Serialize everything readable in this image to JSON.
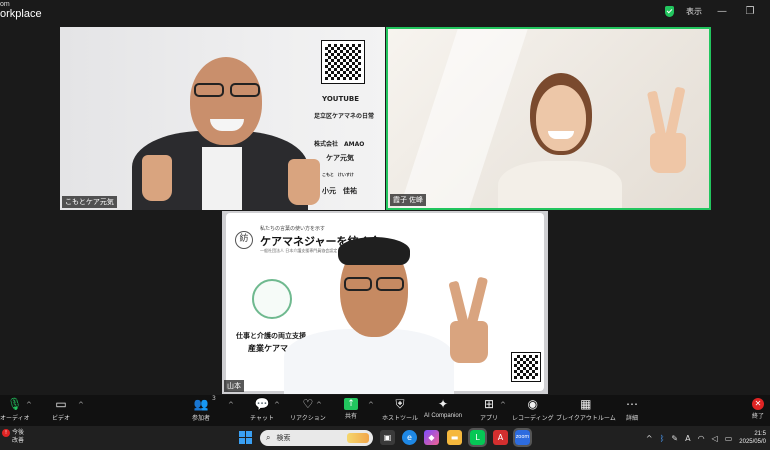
{
  "window": {
    "title_line1": "om",
    "title_line2": "orkplace",
    "view_label": "表示",
    "minimize": "—",
    "restore": "❐"
  },
  "tiles": {
    "a": {
      "name": "こもとケア元気",
      "slide_lines": [
        "YOUTUBE",
        "足立区ケアマネの日常",
        "株式会社　AMAO",
        "ケア元気",
        "こもと　けいすけ",
        "小元　佳祐"
      ]
    },
    "b": {
      "name": "霞子 佐峰"
    },
    "c": {
      "name": "山本",
      "slide_logo": "紡",
      "slide_tagline": "私たちの言葉の使い方を示す",
      "slide_title": "ケアマネジャーを紡ぐ会",
      "slide_subtitle": "一般社団法人 日本介護支援専門員協会認定",
      "slide_line1": "仕事と介護の両立支援",
      "slide_line2": "産業ケアマ"
    }
  },
  "toolbar": {
    "audio": "オーディオ",
    "video": "ビデオ",
    "participants": "参加者",
    "participants_count": "3",
    "chat": "チャット",
    "reactions": "リアクション",
    "share": "共有",
    "host_tools": "ホストツール",
    "ai_companion": "AI Companion",
    "apps": "アプリ",
    "recording": "レコーディング",
    "breakout": "ブレイクアウトルーム",
    "more": "詳細",
    "end": "終了"
  },
  "taskbar": {
    "weather_line1": "今後",
    "weather_line2": "改善",
    "search_placeholder": "検索",
    "clock_time": "21:5",
    "clock_date": "2025/05/0",
    "tray_ime": "A"
  },
  "colors": {
    "active_speaker": "#22c55e",
    "share_green": "#22c55e",
    "end_red": "#e02424",
    "windows_blue": "#3aa0f3"
  }
}
